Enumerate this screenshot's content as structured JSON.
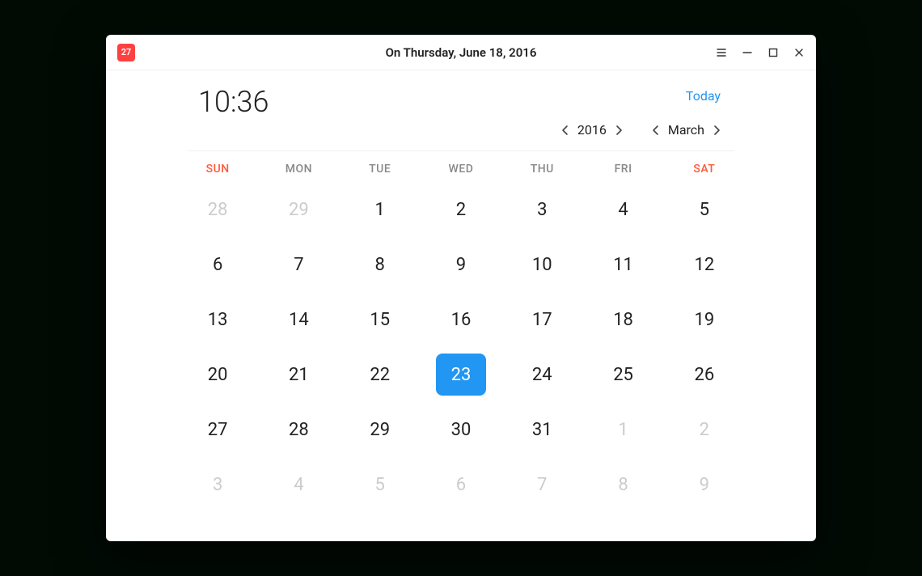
{
  "titlebar": {
    "app_icon_day": "27",
    "title": "On Thursday, June 18, 2016"
  },
  "header": {
    "clock": "10:36",
    "today_label": "Today"
  },
  "nav": {
    "year": "2016",
    "month": "March"
  },
  "weekdays": [
    "SUN",
    "MON",
    "TUE",
    "WED",
    "THU",
    "FRI",
    "SAT"
  ],
  "calendar": {
    "selected_index": 24,
    "days": [
      {
        "n": "28",
        "other": true
      },
      {
        "n": "29",
        "other": true
      },
      {
        "n": "1",
        "other": false
      },
      {
        "n": "2",
        "other": false
      },
      {
        "n": "3",
        "other": false
      },
      {
        "n": "4",
        "other": false
      },
      {
        "n": "5",
        "other": false
      },
      {
        "n": "6",
        "other": false
      },
      {
        "n": "7",
        "other": false
      },
      {
        "n": "8",
        "other": false
      },
      {
        "n": "9",
        "other": false
      },
      {
        "n": "10",
        "other": false
      },
      {
        "n": "11",
        "other": false
      },
      {
        "n": "12",
        "other": false
      },
      {
        "n": "13",
        "other": false
      },
      {
        "n": "14",
        "other": false
      },
      {
        "n": "15",
        "other": false
      },
      {
        "n": "16",
        "other": false
      },
      {
        "n": "17",
        "other": false
      },
      {
        "n": "18",
        "other": false
      },
      {
        "n": "19",
        "other": false
      },
      {
        "n": "20",
        "other": false
      },
      {
        "n": "21",
        "other": false
      },
      {
        "n": "22",
        "other": false
      },
      {
        "n": "23",
        "other": false
      },
      {
        "n": "24",
        "other": false
      },
      {
        "n": "25",
        "other": false
      },
      {
        "n": "26",
        "other": false
      },
      {
        "n": "27",
        "other": false
      },
      {
        "n": "28",
        "other": false
      },
      {
        "n": "29",
        "other": false
      },
      {
        "n": "30",
        "other": false
      },
      {
        "n": "31",
        "other": false
      },
      {
        "n": "1",
        "other": true
      },
      {
        "n": "2",
        "other": true
      },
      {
        "n": "3",
        "other": true
      },
      {
        "n": "4",
        "other": true
      },
      {
        "n": "5",
        "other": true
      },
      {
        "n": "6",
        "other": true
      },
      {
        "n": "7",
        "other": true
      },
      {
        "n": "8",
        "other": true
      },
      {
        "n": "9",
        "other": true
      }
    ]
  }
}
